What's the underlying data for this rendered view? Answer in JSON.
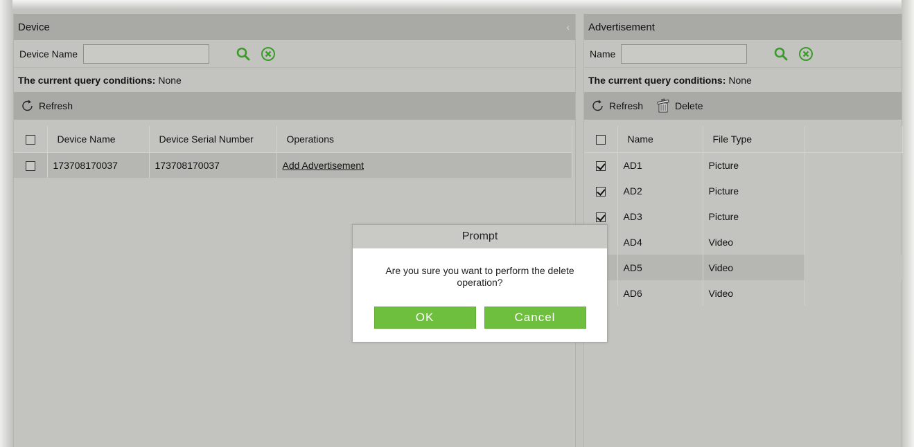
{
  "device_panel": {
    "title": "Device",
    "search_label": "Device Name",
    "search_value": "",
    "query_label": "The current query conditions:",
    "query_value": "None",
    "refresh_label": "Refresh",
    "columns": [
      "Device Name",
      "Device Serial Number",
      "Operations"
    ],
    "rows": [
      {
        "device_name": "173708170037",
        "serial": "173708170037",
        "operation": "Add Advertisement"
      }
    ]
  },
  "ad_panel": {
    "title": "Advertisement",
    "search_label": "Name",
    "search_value": "",
    "query_label": "The current query conditions:",
    "query_value": "None",
    "refresh_label": "Refresh",
    "delete_label": "Delete",
    "columns": [
      "Name",
      "File Type"
    ],
    "rows": [
      {
        "name": "AD1",
        "type": "Picture",
        "checked": true
      },
      {
        "name": "AD2",
        "type": "Picture",
        "checked": true
      },
      {
        "name": "AD3",
        "type": "Picture",
        "checked": true
      },
      {
        "name": "AD4",
        "type": "Video",
        "checked": true
      },
      {
        "name": "AD5",
        "type": "Video",
        "checked": true
      },
      {
        "name": "AD6",
        "type": "Video",
        "checked": true
      }
    ]
  },
  "dialog": {
    "title": "Prompt",
    "message": "Are you sure you want to perform the delete operation?",
    "ok_label": "OK",
    "cancel_label": "Cancel"
  },
  "colors": {
    "accent_green": "#6fbf3f",
    "icon_green": "#3c9a2c",
    "panel_header": "#a9aaa5"
  },
  "icons": [
    "search-icon",
    "clear-icon",
    "refresh-icon",
    "delete-icon",
    "collapse-icon"
  ]
}
